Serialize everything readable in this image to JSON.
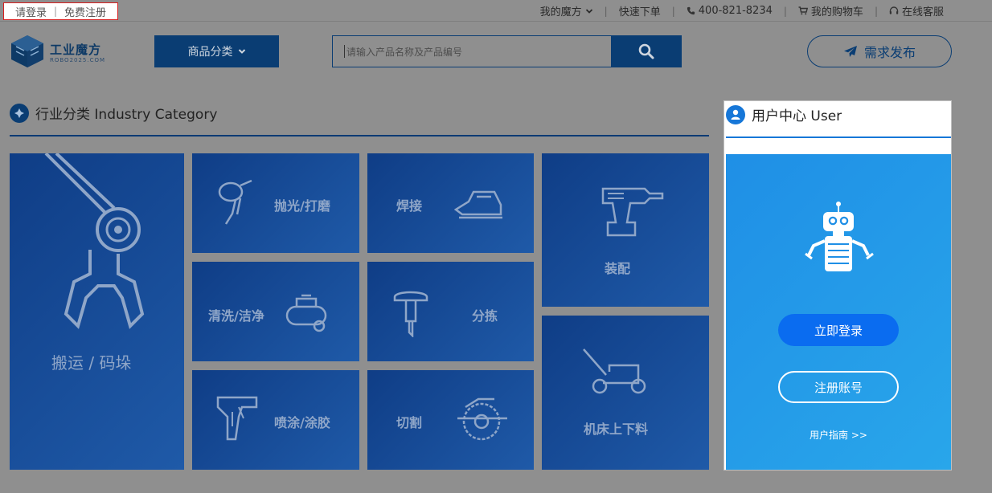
{
  "topbar": {
    "login": "请登录",
    "register": "免费注册",
    "my_mofang": "我的魔方",
    "quick_order": "快速下单",
    "phone": "400-821-8234",
    "cart": "我的购物车",
    "service": "在线客服"
  },
  "header": {
    "logo_title": "工业魔方",
    "logo_sub": "ROBO2025.COM",
    "category_button": "商品分类",
    "search_placeholder": "请输入产品名称及产品编号",
    "demand_button": "需求发布"
  },
  "industry": {
    "title": "行业分类 Industry Category",
    "tiles": [
      {
        "label": "搬运 / 码垛",
        "icon": "robot-gripper-icon"
      },
      {
        "label": "抛光/打磨",
        "icon": "angle-grinder-icon"
      },
      {
        "label": "焊接",
        "icon": "soldering-iron-icon"
      },
      {
        "label": "装配",
        "icon": "drill-icon"
      },
      {
        "label": "清洗/洁净",
        "icon": "air-compressor-icon"
      },
      {
        "label": "分拣",
        "icon": "jackhammer-icon"
      },
      {
        "label": "喷涂/涂胶",
        "icon": "glue-gun-icon"
      },
      {
        "label": "切割",
        "icon": "circular-saw-icon"
      },
      {
        "label": "机床上下料",
        "icon": "lawn-mower-icon"
      }
    ]
  },
  "user_center": {
    "title": "用户中心 User",
    "login_button": "立即登录",
    "register_button": "注册账号",
    "guide": "用户指南 >>"
  },
  "colors": {
    "dark_blue": "#0a3d73",
    "accent_blue": "#1677d8",
    "login_blue": "#0a6cf0"
  }
}
